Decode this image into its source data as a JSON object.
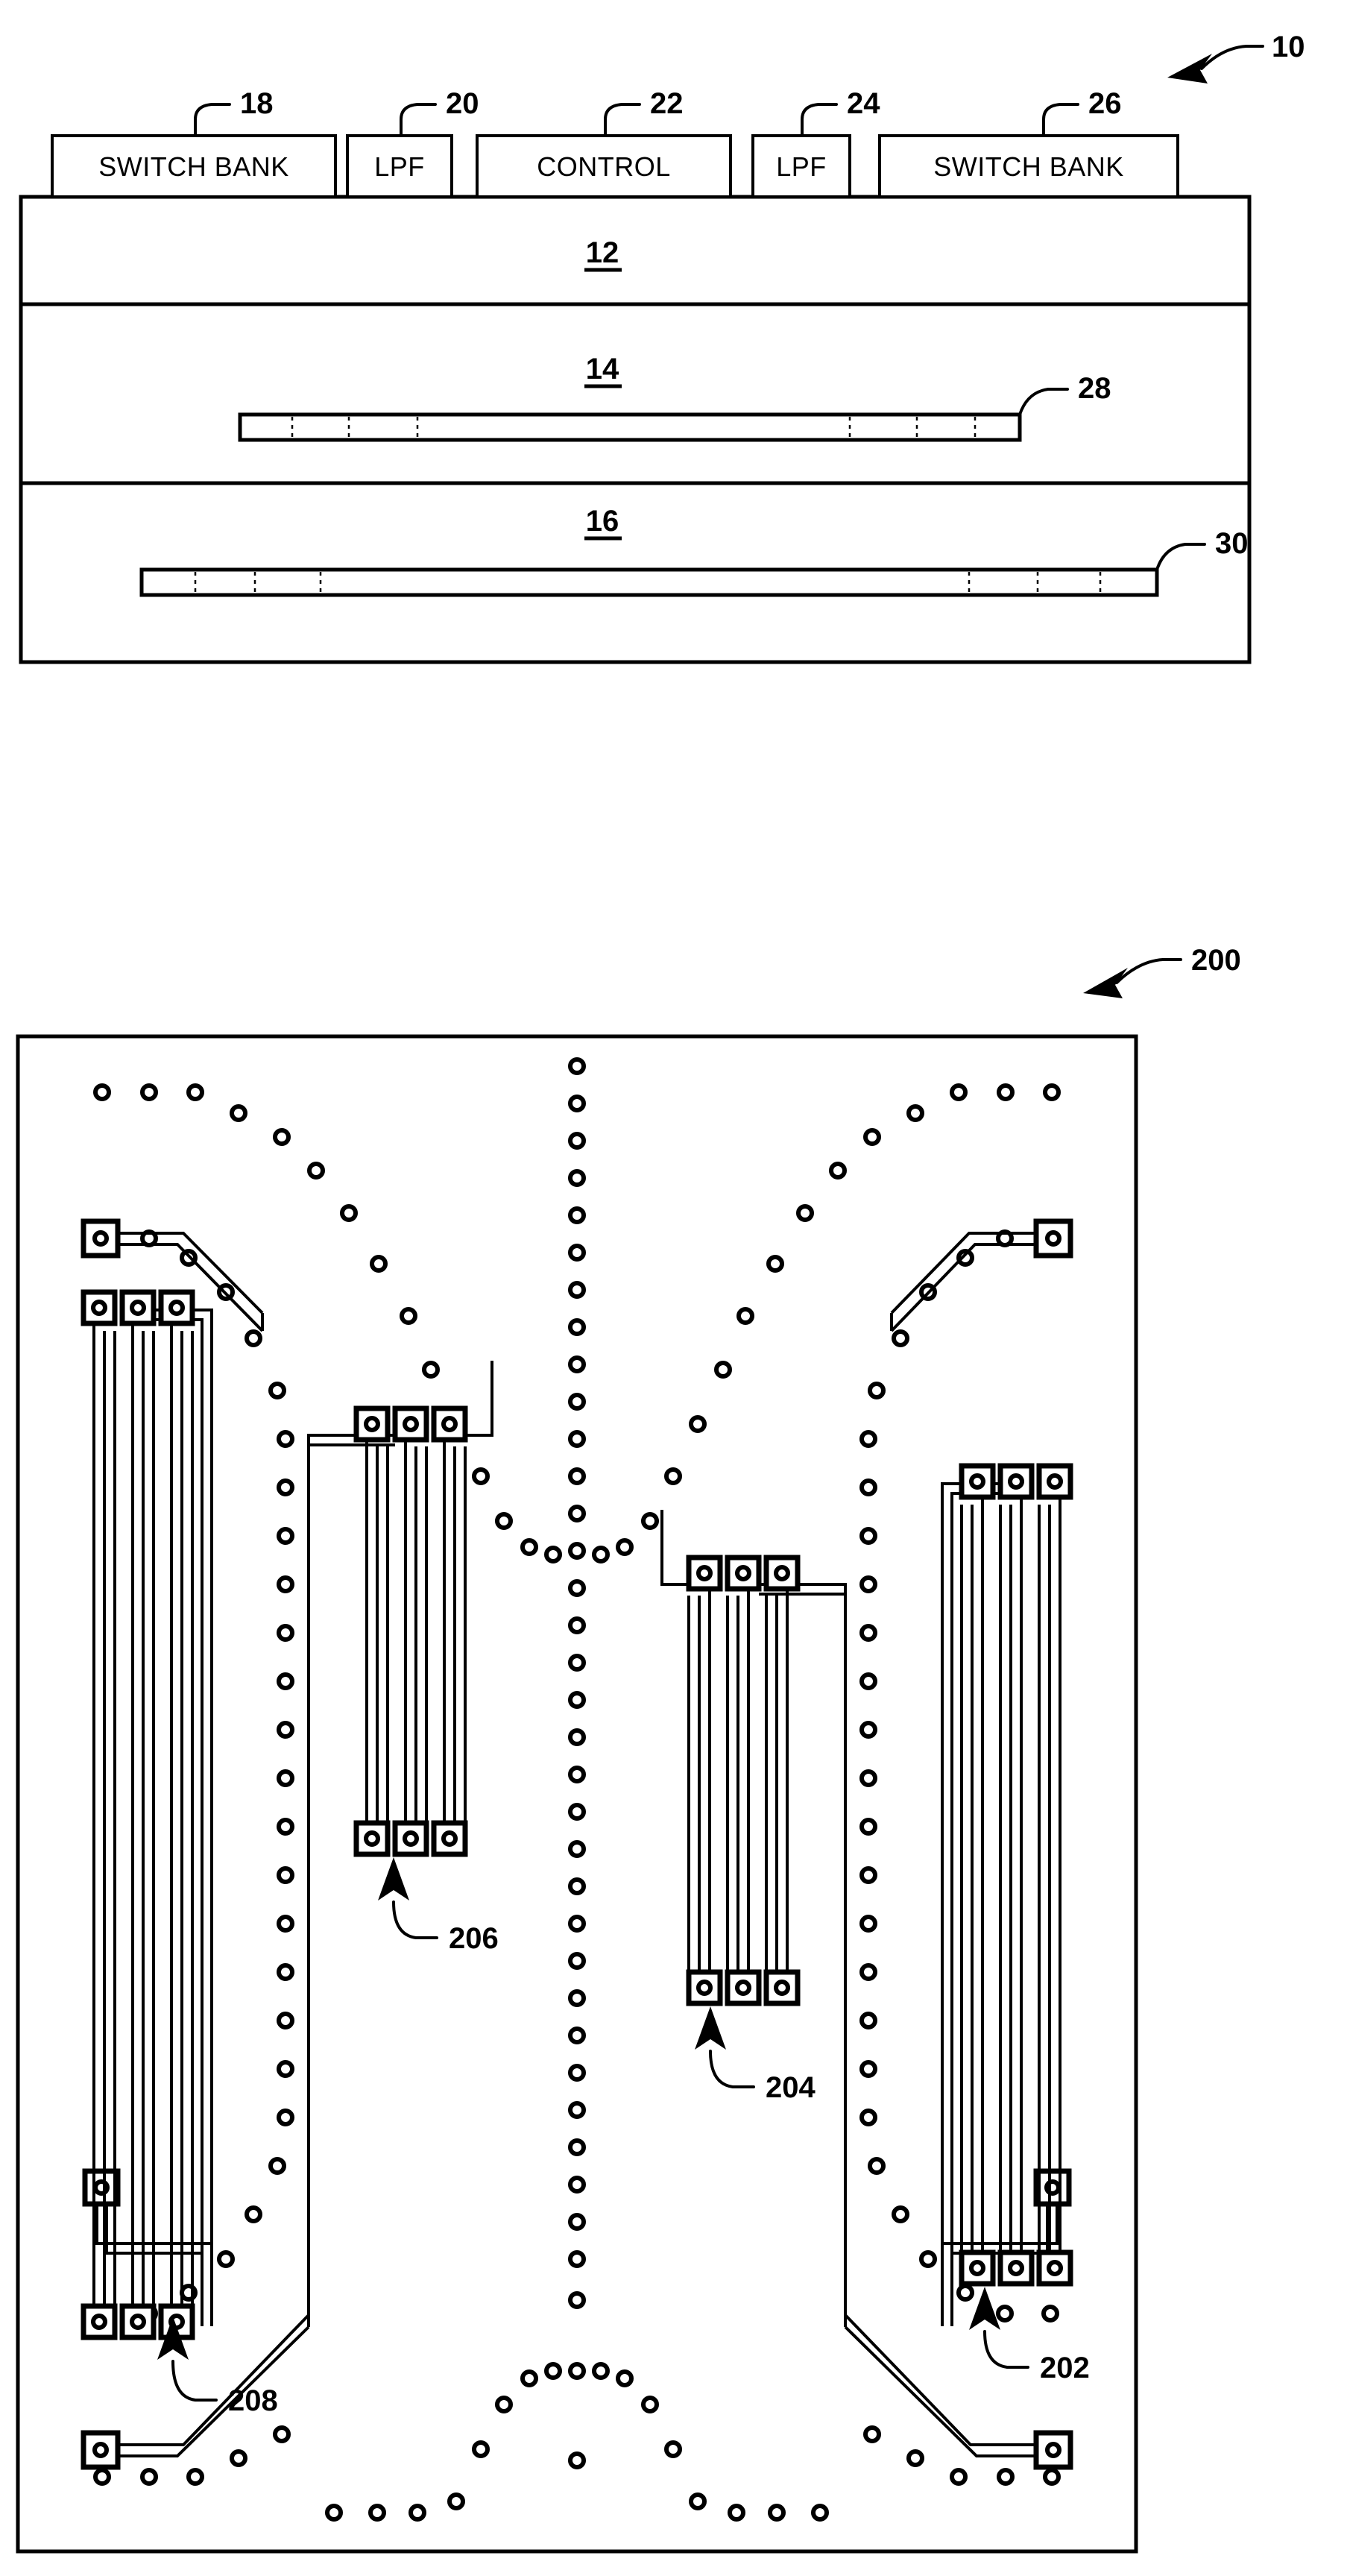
{
  "figures": [
    {
      "id": "fig-block-diagram",
      "reference_numeral": "10",
      "blocks": [
        {
          "ref": "18",
          "label": "SWITCH BANK"
        },
        {
          "ref": "20",
          "label": "LPF"
        },
        {
          "ref": "22",
          "label": "CONTROL"
        },
        {
          "ref": "24",
          "label": "LPF"
        },
        {
          "ref": "26",
          "label": "SWITCH BANK"
        }
      ],
      "layers": [
        {
          "ref": "12"
        },
        {
          "ref": "14"
        },
        {
          "ref": "16"
        }
      ],
      "embedded_elements": [
        {
          "ref": "28",
          "in_layer": "14"
        },
        {
          "ref": "30",
          "in_layer": "16"
        }
      ]
    },
    {
      "id": "fig-pcb-layout",
      "reference_numeral": "200",
      "comb_structures": [
        {
          "ref": "202",
          "position": "outer-right"
        },
        {
          "ref": "204",
          "position": "inner-right"
        },
        {
          "ref": "206",
          "position": "inner-left"
        },
        {
          "ref": "208",
          "position": "outer-left"
        }
      ]
    }
  ],
  "colors": {
    "ink": "#000000",
    "paper": "#ffffff"
  }
}
